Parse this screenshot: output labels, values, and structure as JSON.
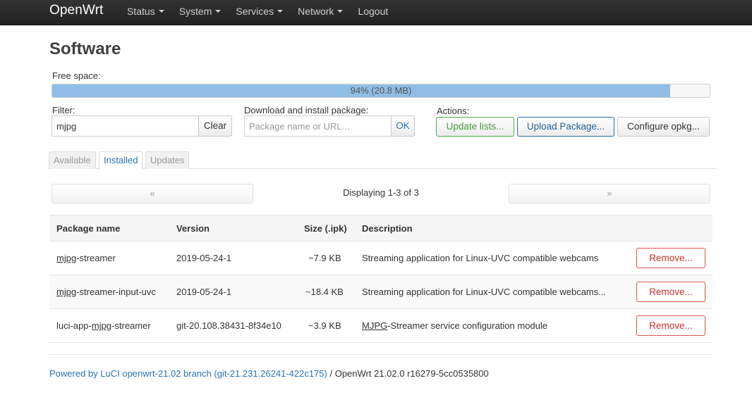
{
  "navbar": {
    "brand": "OpenWrt",
    "items": [
      {
        "label": "Status",
        "dropdown": true
      },
      {
        "label": "System",
        "dropdown": true
      },
      {
        "label": "Services",
        "dropdown": true
      },
      {
        "label": "Network",
        "dropdown": true
      },
      {
        "label": "Logout",
        "dropdown": false
      }
    ]
  },
  "page": {
    "title": "Software"
  },
  "free_space": {
    "label": "Free space:",
    "percent": 94,
    "text": "94% (20.8 MB)"
  },
  "filter": {
    "label": "Filter:",
    "value": "mjpg",
    "clear_label": "Clear"
  },
  "download": {
    "label": "Download and install package:",
    "placeholder": "Package name or URL...",
    "ok_label": "OK"
  },
  "actions": {
    "label": "Actions:",
    "update_lists": "Update lists...",
    "upload_package": "Upload Package...",
    "configure_opkg": "Configure opkg..."
  },
  "tabs": {
    "available": "Available",
    "installed": "Installed",
    "updates": "Updates",
    "active": "installed"
  },
  "pager": {
    "prev": "«",
    "next": "»",
    "status": "Displaying 1-3 of 3"
  },
  "table": {
    "headers": {
      "name": "Package name",
      "version": "Version",
      "size": "Size (.ipk)",
      "description": "Description"
    },
    "rows": [
      {
        "name_prefix": "",
        "name_match": "mjpg",
        "name_suffix": "-streamer",
        "version": "2019-05-24-1",
        "size": "~7.9 KB",
        "desc_prefix": "",
        "desc_match": "",
        "desc_suffix": "Streaming application for Linux-UVC compatible webcams",
        "action": "Remove..."
      },
      {
        "name_prefix": "",
        "name_match": "mjpg",
        "name_suffix": "-streamer-input-uvc",
        "version": "2019-05-24-1",
        "size": "~18.4 KB",
        "desc_prefix": "",
        "desc_match": "",
        "desc_suffix": "Streaming application for Linux-UVC compatible webcams...",
        "action": "Remove..."
      },
      {
        "name_prefix": "luci-app-",
        "name_match": "mjpg",
        "name_suffix": "-streamer",
        "version": "git-20.108.38431-8f34e10",
        "size": "~3.9 KB",
        "desc_prefix": "",
        "desc_match": "MJPG",
        "desc_suffix": "-Streamer service configuration module",
        "action": "Remove..."
      }
    ]
  },
  "footer": {
    "link_text": "Powered by LuCI openwrt-21.02 branch (git-21.231.26241-422c175)",
    "separator": " / ",
    "version_text": "OpenWrt 21.02.0 r16279-5cc0535800"
  }
}
